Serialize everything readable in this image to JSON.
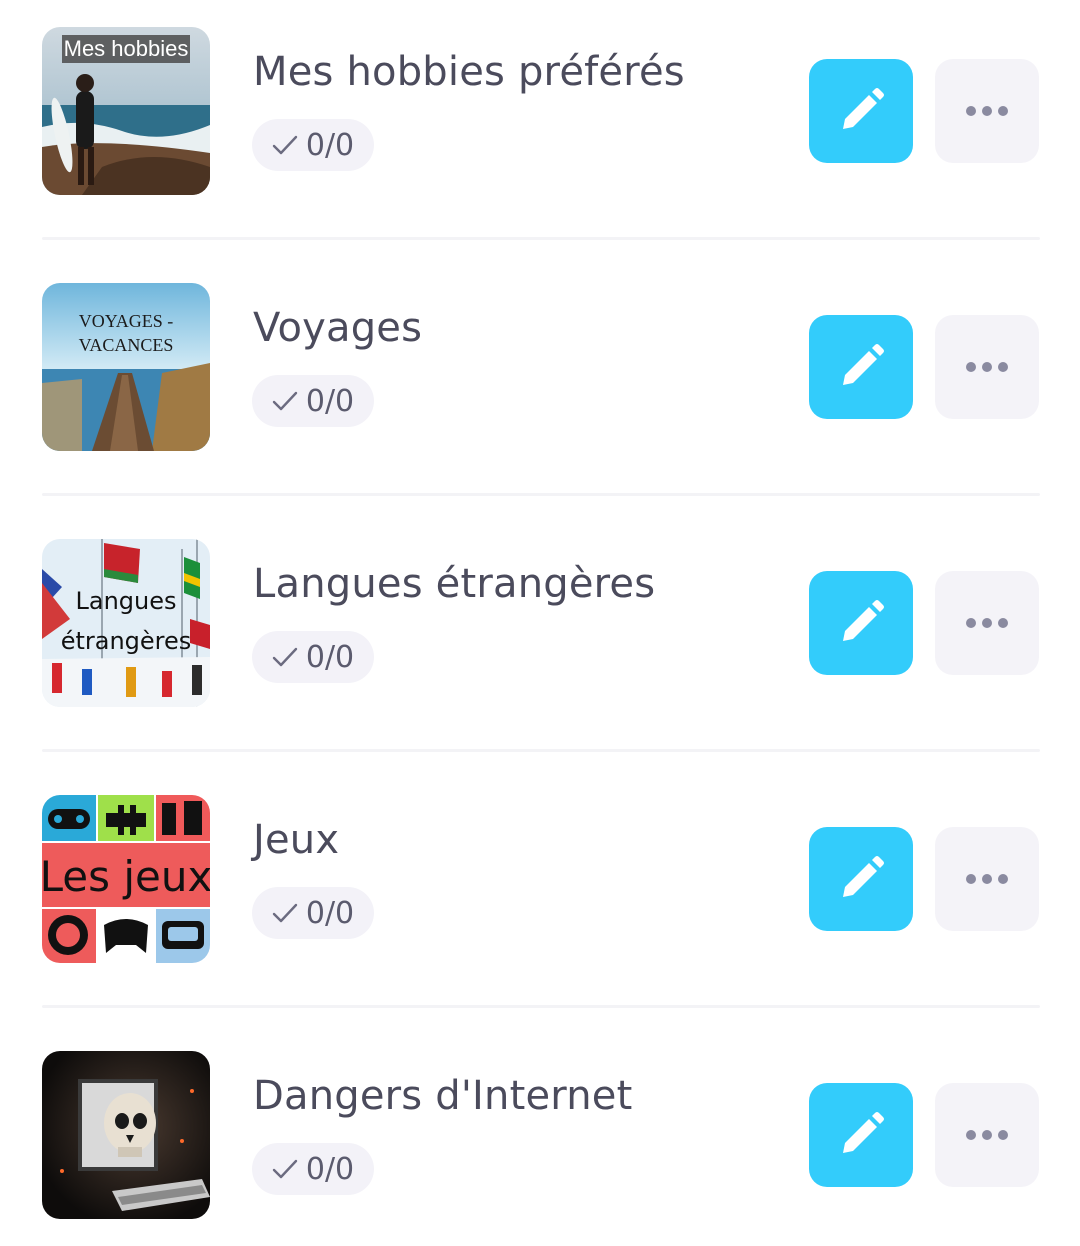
{
  "colors": {
    "accent": "#33ccfb",
    "title_text": "#4b4b5c",
    "badge_bg": "#f3f2f8",
    "more_bg": "#f4f3f8",
    "more_dots": "#8a8aa0"
  },
  "icons": {
    "edit": "pencil-icon",
    "more": "more-horizontal-icon",
    "progress": "check-icon"
  },
  "items": [
    {
      "title": "Mes hobbies préférés",
      "progress": "0/0",
      "thumb_caption": "Mes hobbies"
    },
    {
      "title": "Voyages",
      "progress": "0/0",
      "thumb_caption_line1": "VOYAGES -",
      "thumb_caption_line2": "VACANCES"
    },
    {
      "title": "Langues étrangères",
      "progress": "0/0",
      "thumb_caption_line1": "Langues",
      "thumb_caption_line2": "étrangères"
    },
    {
      "title": "Jeux",
      "progress": "0/0",
      "thumb_caption": "Les jeux"
    },
    {
      "title": "Dangers d'Internet",
      "progress": "0/0"
    }
  ]
}
